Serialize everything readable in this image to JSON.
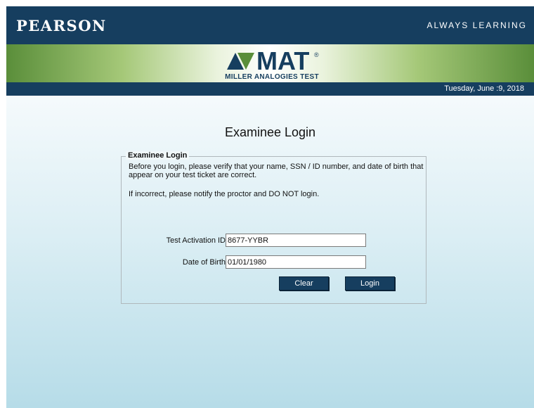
{
  "header": {
    "brand": "PEARSON",
    "tagline": "ALWAYS LEARNING"
  },
  "logo": {
    "name": "MAT",
    "subtitle": "MILLER ANALOGIES TEST",
    "registered": "®"
  },
  "datebar": {
    "date": "Tuesday, June :9, 2018"
  },
  "page": {
    "title": "Examinee Login"
  },
  "login_box": {
    "legend": "Examinee Login",
    "instructions": "Before you login, please verify that your name, SSN / ID number, and date of birth that appear on your test ticket are correct.",
    "warning": "If incorrect, please notify the proctor and DO NOT login.",
    "activation_label": "Test Activation ID",
    "activation_value": "8677-YYBR",
    "dob_label": "Date of Birth",
    "dob_value": "01/01/1980",
    "clear_label": "Clear",
    "login_label": "Login"
  },
  "colors": {
    "navy": "#163e5f",
    "green": "#5a8e3a"
  }
}
